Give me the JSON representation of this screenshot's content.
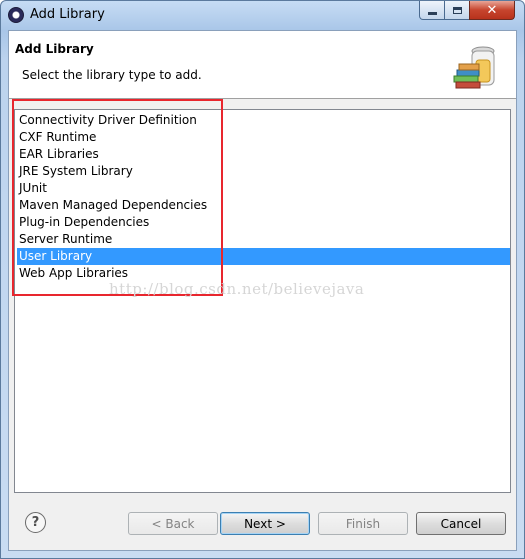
{
  "window": {
    "title": "Add Library"
  },
  "header": {
    "title": "Add Library",
    "description": "Select the library type to add."
  },
  "library_types": [
    {
      "label": "Connectivity Driver Definition",
      "selected": false
    },
    {
      "label": "CXF Runtime",
      "selected": false
    },
    {
      "label": "EAR Libraries",
      "selected": false
    },
    {
      "label": "JRE System Library",
      "selected": false
    },
    {
      "label": "JUnit",
      "selected": false
    },
    {
      "label": "Maven Managed Dependencies",
      "selected": false
    },
    {
      "label": "Plug-in Dependencies",
      "selected": false
    },
    {
      "label": "Server Runtime",
      "selected": false
    },
    {
      "label": "User Library",
      "selected": true
    },
    {
      "label": "Web App Libraries",
      "selected": false
    }
  ],
  "watermark": "http://blog.csdn.net/believejava",
  "buttons": {
    "help": "?",
    "back": "< Back",
    "next": "Next >",
    "finish": "Finish",
    "cancel": "Cancel"
  },
  "colors": {
    "selection": "#3399ff",
    "annotation_box": "#e8262e"
  },
  "icons": {
    "app": "eclipse-icon",
    "header": "library-jar-books-icon",
    "help": "help-icon"
  }
}
